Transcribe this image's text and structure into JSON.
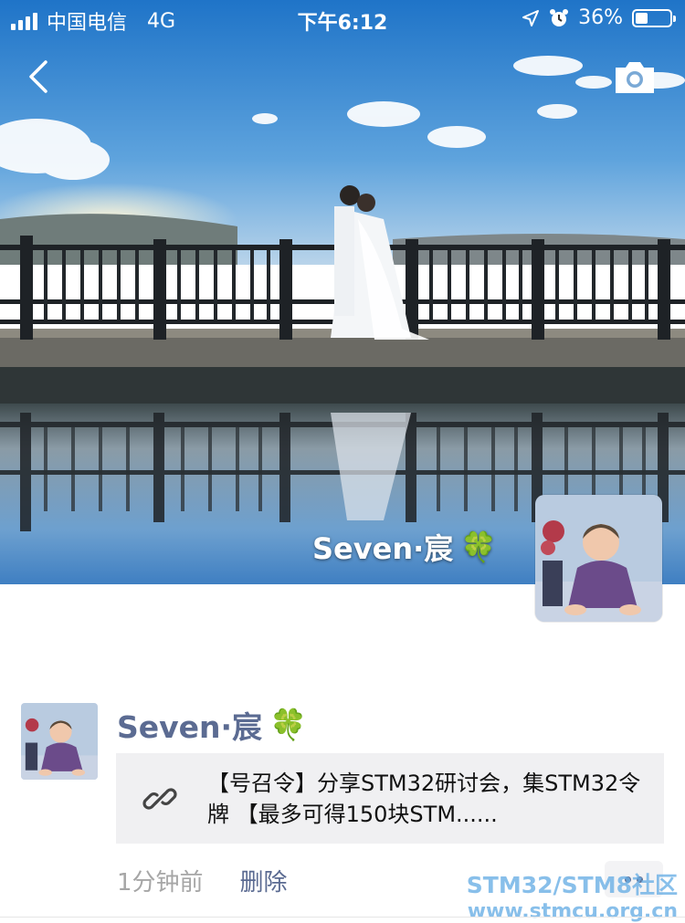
{
  "status_bar": {
    "carrier": "中国电信",
    "network": "4G",
    "time": "下午6:12",
    "battery_text": "36%",
    "battery_level": 0.36
  },
  "cover": {
    "scene": "wedding couple kissing on a wooden pier with railing, blue sky and clouds, reflected in still water",
    "username": "Seven·宸",
    "emoji": "🍀"
  },
  "post": {
    "username": "Seven·宸",
    "emoji": "🍀",
    "link_text": "【号召令】分享STM32研讨会，集STM32令牌 【最多可得150块STM......",
    "time_ago": "1分钟前",
    "delete_label": "删除"
  },
  "watermark": {
    "line1": "STM32/STM8社区",
    "line2": "www.stmcu.org.cn"
  },
  "colors": {
    "name_blue": "#5b6b92",
    "card_bg": "#f0f0f2",
    "watermark": "#6bb0e6"
  },
  "icons": [
    "signal-icon",
    "location-icon",
    "alarm-icon",
    "battery-icon",
    "back-arrow-icon",
    "camera-icon",
    "link-icon",
    "more-dots-icon"
  ]
}
